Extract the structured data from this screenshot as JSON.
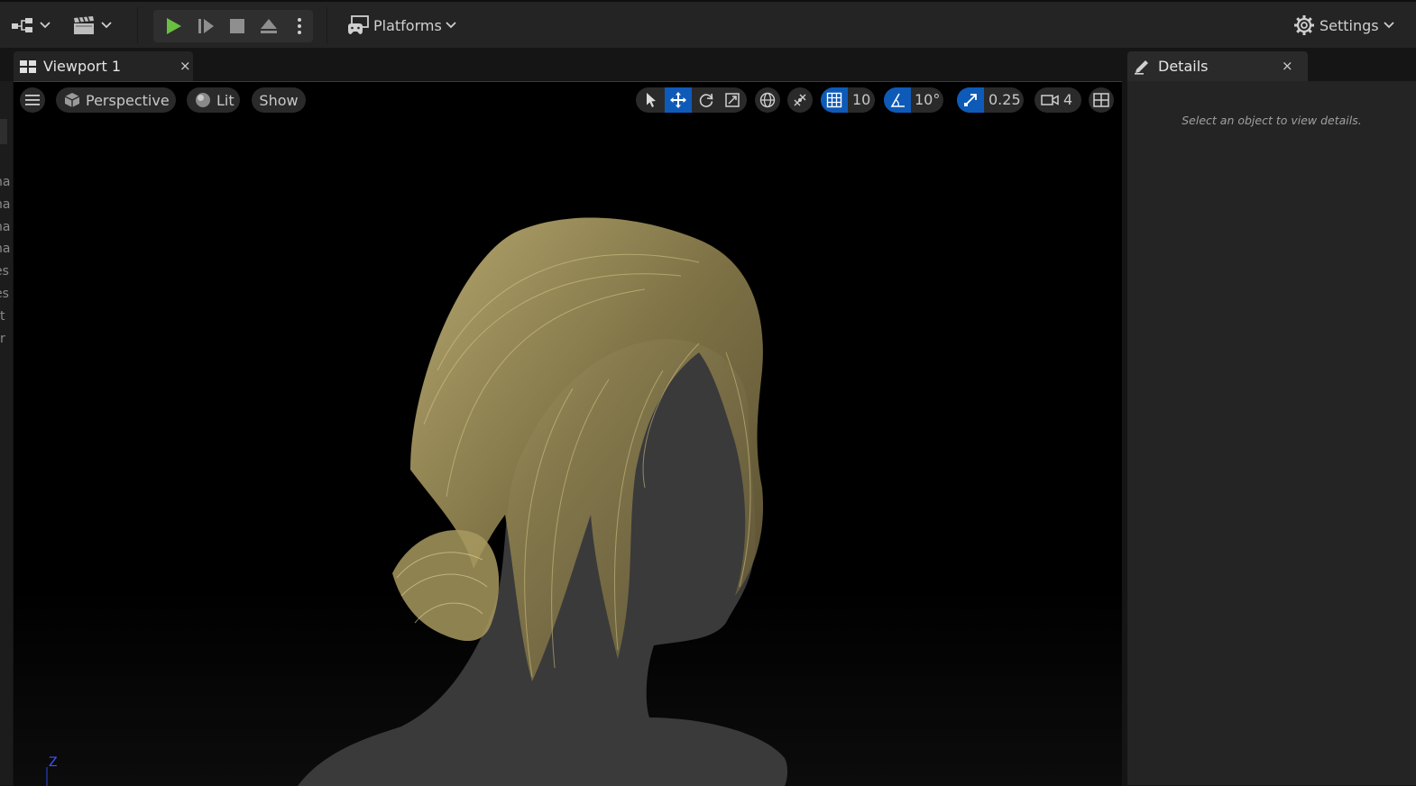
{
  "toolbar": {
    "platforms_label": "Platforms",
    "settings_label": "Settings"
  },
  "tabs": {
    "viewport_label": "Viewport 1",
    "details_label": "Details",
    "close_glyph": "×"
  },
  "left_panel": {
    "rows": [
      "na",
      "na",
      "na",
      "na",
      "es",
      "es",
      "t",
      "r"
    ]
  },
  "viewport": {
    "perspective_label": "Perspective",
    "lit_label": "Lit",
    "show_label": "Show",
    "grid_snap_value": "10",
    "rotation_snap_value": "10°",
    "scale_snap_value": "0.25",
    "camera_speed_value": "4",
    "axis_label": "Z"
  },
  "details": {
    "empty_message": "Select an object to view details."
  },
  "colors": {
    "accent": "#0070e0",
    "play_green": "#6abf40",
    "hair": "#b8a86a"
  }
}
